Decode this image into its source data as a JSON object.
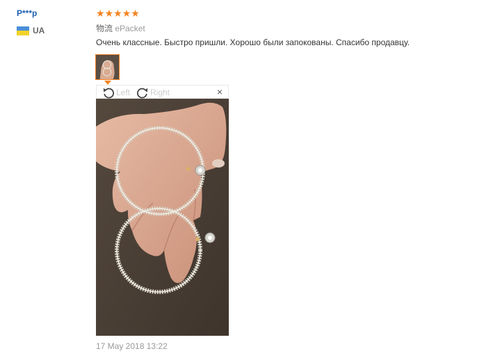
{
  "reviewer": {
    "name": "P***p",
    "country_code": "UA",
    "flag_colors": [
      "#4a8fd8",
      "#f2d22a"
    ]
  },
  "review": {
    "rating": 5,
    "rating_max": 5,
    "star_color": "#f5821f",
    "logistics_label": "物流",
    "logistics_value": "ePacket",
    "text": "Очень классные. Быстро пришли. Хорошо были запокованы. Спасибо продавцу.",
    "date": "17 May 2018 13:22"
  },
  "viewer": {
    "rotate_left_label": "Left",
    "rotate_right_label": "Right",
    "close_label": "×"
  },
  "icons": [
    "rotate-left-icon",
    "rotate-right-icon",
    "close-icon"
  ]
}
